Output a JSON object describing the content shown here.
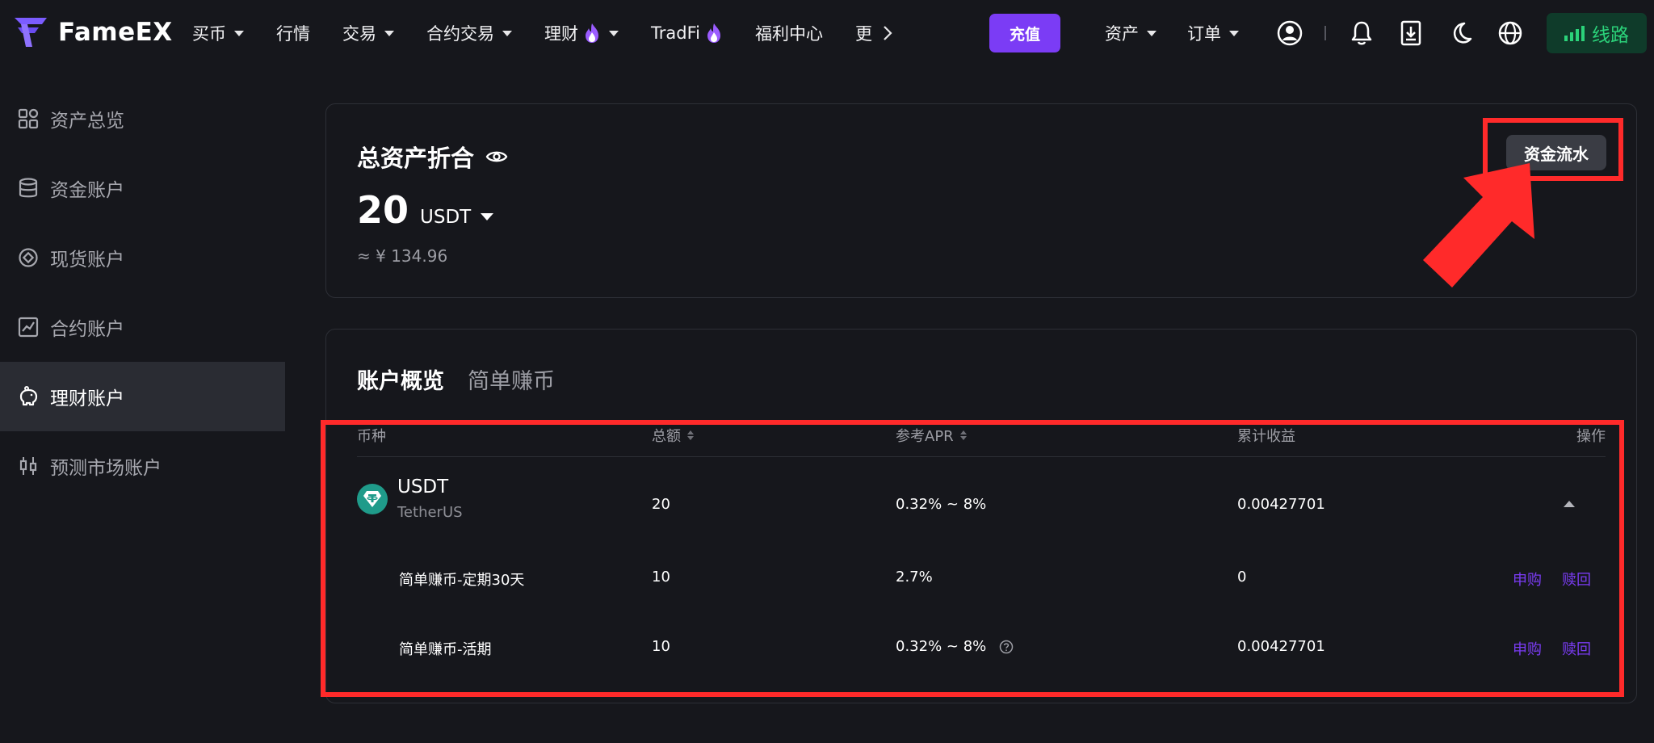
{
  "brand": {
    "name": "FameEX"
  },
  "nav": {
    "items": [
      {
        "label": "买币",
        "caret": true,
        "fire": false
      },
      {
        "label": "行情",
        "caret": false,
        "fire": false
      },
      {
        "label": "交易",
        "caret": true,
        "fire": false
      },
      {
        "label": "合约交易",
        "caret": true,
        "fire": false
      },
      {
        "label": "理财",
        "caret": true,
        "fire": true
      },
      {
        "label": "TradFi",
        "caret": false,
        "fire": true
      },
      {
        "label": "福利中心",
        "caret": false,
        "fire": false
      },
      {
        "label": "更",
        "caret": false,
        "fire": false
      }
    ],
    "deposit_label": "充值",
    "right_items": [
      {
        "label": "资产"
      },
      {
        "label": "订单"
      }
    ],
    "line_label": "线路"
  },
  "sidebar": {
    "items": [
      {
        "label": "资产总览",
        "icon": "grid-icon"
      },
      {
        "label": "资金账户",
        "icon": "database-icon"
      },
      {
        "label": "现货账户",
        "icon": "spot-icon"
      },
      {
        "label": "合约账户",
        "icon": "chart-icon"
      },
      {
        "label": "理财账户",
        "icon": "piggy-icon",
        "active": true
      },
      {
        "label": "预测市场账户",
        "icon": "candles-icon"
      }
    ]
  },
  "assets": {
    "title": "总资产折合",
    "value": "20",
    "unit": "USDT",
    "approx": "≈ ¥ 134.96",
    "flow_label": "资金流水"
  },
  "overview": {
    "tabs": [
      "账户概览",
      "简单赚币"
    ],
    "columns": {
      "coin": "币种",
      "total": "总额",
      "apr": "参考APR",
      "earnings": "累计收益",
      "action": "操作"
    },
    "coin_row": {
      "symbol": "USDT",
      "name": "TetherUS",
      "total": "20",
      "apr": "0.32% ~ 8%",
      "earnings": "0.00427701"
    },
    "products": [
      {
        "name": "简单赚币-定期30天",
        "total": "10",
        "apr": "2.7%",
        "earnings": "0",
        "subscribe": "申购",
        "redeem": "赎回"
      },
      {
        "name": "简单赚币-活期",
        "total": "10",
        "apr": "0.32% ~ 8%",
        "earnings": "0.00427701",
        "subscribe": "申购",
        "redeem": "赎回"
      }
    ]
  },
  "colors": {
    "accent": "#7b3cf5",
    "background": "#16171c",
    "annotation": "#ff2a2a",
    "line_green": "#2bd27a"
  }
}
